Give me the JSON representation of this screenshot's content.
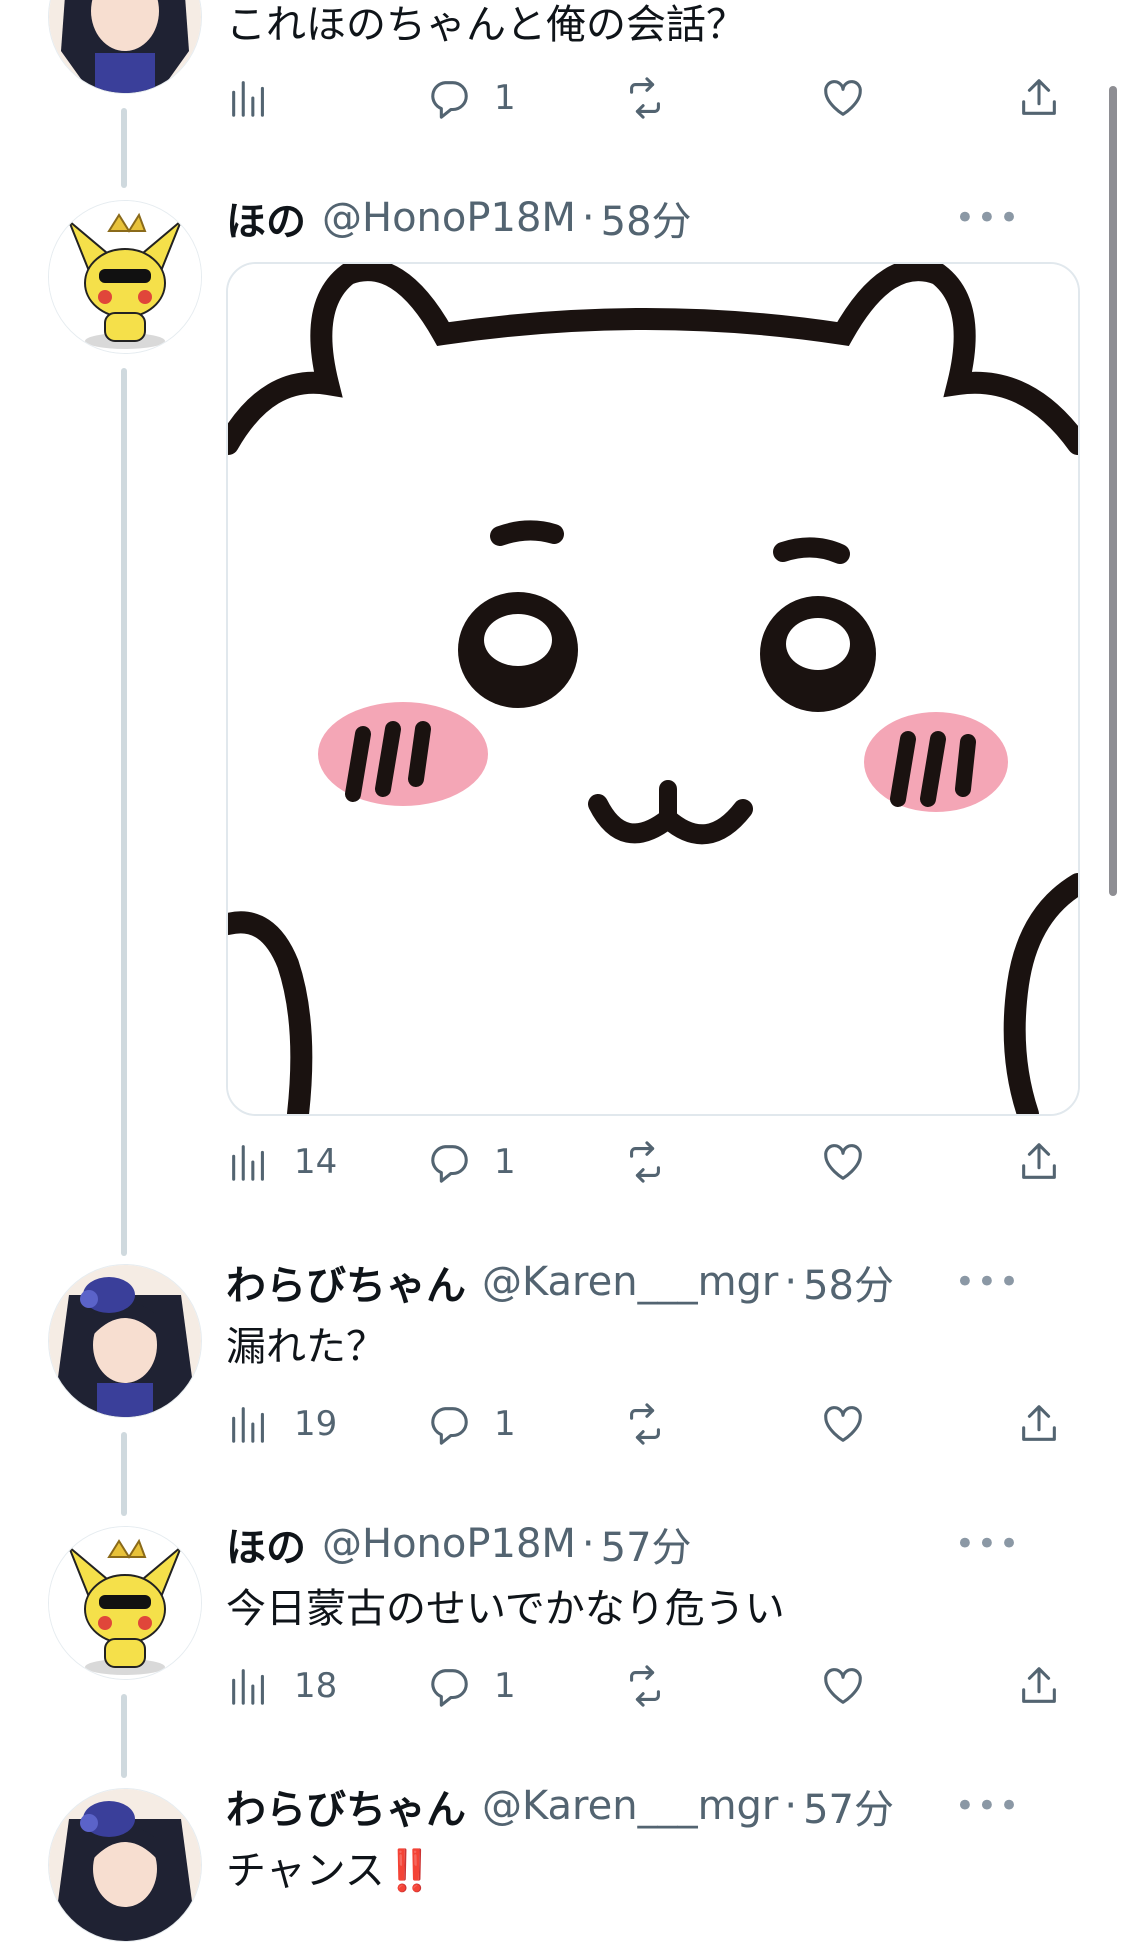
{
  "tweets": [
    {
      "text": "これほのちゃんと俺の会話？",
      "views": "",
      "replies": "1"
    },
    {
      "name": "ほの",
      "handle": "@HonoP18M",
      "time": "58分",
      "views": "14",
      "replies": "1"
    },
    {
      "name": "わらびちゃん",
      "handle": "@Karen___mgr",
      "time": "58分",
      "text": "漏れた？",
      "views": "19",
      "replies": "1"
    },
    {
      "name": "ほの",
      "handle": "@HonoP18M",
      "time": "57分",
      "text": "今日蒙古のせいでかなり危うい",
      "views": "18",
      "replies": "1"
    },
    {
      "name": "わらびちゃん",
      "handle": "@Karen___mgr",
      "time": "57分",
      "text": "チャンス",
      "emoji": "‼️"
    }
  ],
  "ui": {
    "dot": "·",
    "more": "•••"
  },
  "icons": {
    "views": "bar-chart-icon",
    "reply": "speech-bubble-icon",
    "retweet": "retweet-icon",
    "like": "heart-icon",
    "share": "share-icon"
  },
  "colors": {
    "text": "#0f1419",
    "secondary": "#536471",
    "thread_line": "#cfd9de",
    "blush": "#f4a6b6"
  }
}
